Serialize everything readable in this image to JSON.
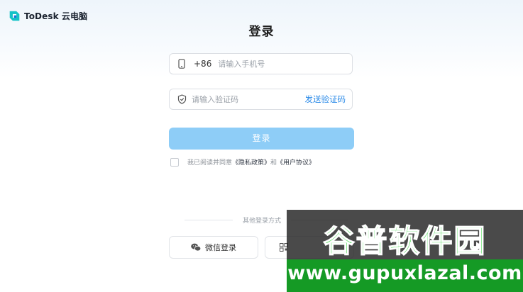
{
  "app": {
    "logo_text": "ToDesk 云电脑",
    "logo_icon": "todesk-logo-icon",
    "brand_color": "#12c2c7"
  },
  "login": {
    "title": "登录",
    "phone": {
      "country_code": "+86",
      "placeholder": "请输入手机号",
      "value": "",
      "icon": "phone-icon"
    },
    "code": {
      "placeholder": "请输入验证码",
      "value": "",
      "icon": "shield-icon",
      "send_label": "发送验证码"
    },
    "submit_label": "登录",
    "submit_color": "#8ecdf7",
    "agreement": {
      "checked": false,
      "prefix": "我已阅读并同意",
      "privacy_link": "《隐私政策》",
      "conjunction": "和",
      "terms_link": "《用户协议》"
    }
  },
  "other_login": {
    "label": "其他登录方式",
    "wechat_label": "微信登录",
    "wechat_icon": "wechat-icon",
    "second_icon": "qr-code-icon"
  },
  "watermark": {
    "title": "谷普软件园",
    "url": "www.gupuxlazal.com"
  }
}
